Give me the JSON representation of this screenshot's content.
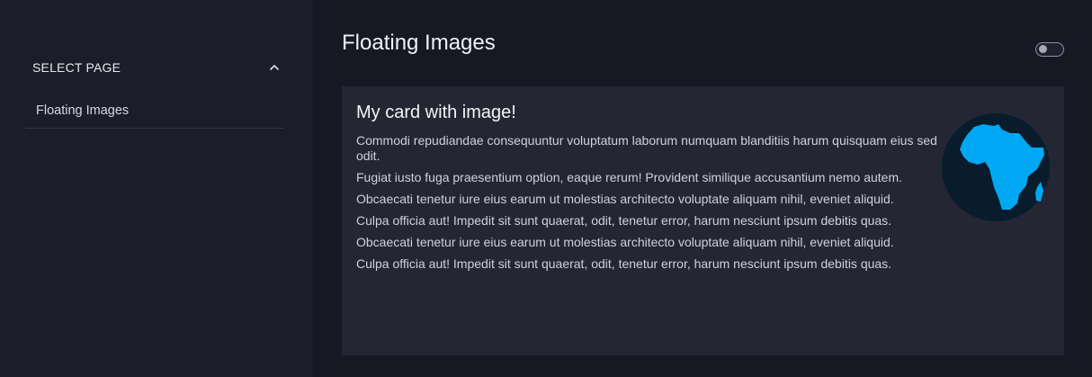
{
  "sidebar": {
    "select_title": "SELECT PAGE",
    "items": [
      {
        "label": "Floating Images"
      }
    ]
  },
  "main": {
    "title": "Floating Images",
    "toggle_state": "off"
  },
  "card": {
    "title": "My card with image!",
    "image_icon": "africa-globe-icon",
    "paragraphs": [
      "Commodi repudiandae consequuntur voluptatum laborum numquam blanditiis harum quisquam eius sed odit.",
      "Fugiat iusto fuga praesentium option, eaque rerum! Provident similique accusantium nemo autem.",
      "Obcaecati tenetur iure eius earum ut molestias architecto voluptate aliquam nihil, eveniet aliquid.",
      "Culpa officia aut! Impedit sit sunt quaerat, odit, tenetur error, harum nesciunt ipsum debitis quas.",
      "Obcaecati tenetur iure eius earum ut molestias architecto voluptate aliquam nihil, eveniet aliquid.",
      "Culpa officia aut! Impedit sit sunt quaerat, odit, tenetur error, harum nesciunt ipsum debitis quas."
    ]
  },
  "colors": {
    "page_background": "#161823",
    "sidebar_background": "#1b1d2a",
    "card_background": "#242634",
    "globe_ocean": "#081c2c",
    "globe_land": "#00a8f3"
  }
}
